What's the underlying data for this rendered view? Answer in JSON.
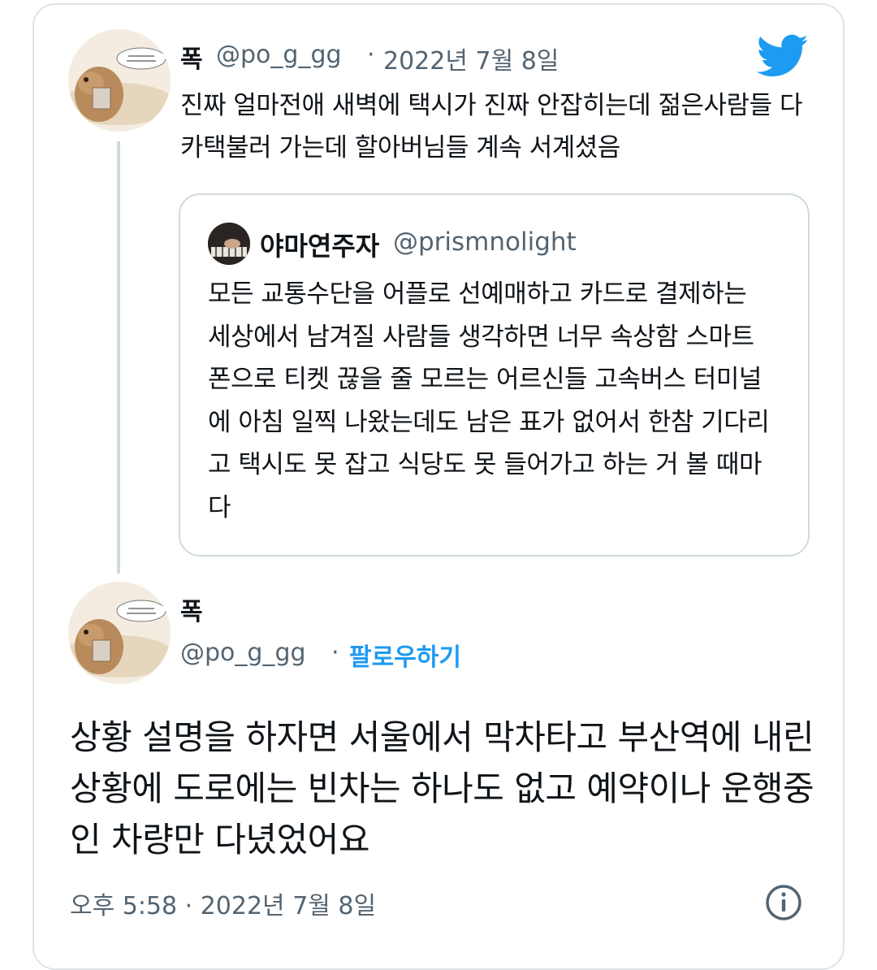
{
  "tweet": {
    "author_name": "폭",
    "author_handle": "@po_g_gg",
    "separator": "·",
    "date": "2022년 7월 8일",
    "text": "진짜 얼마전애 새벽에 택시가 진짜 안잡히는데 젊은사람들 다 카택불러 가는데 할아버님들 계속 서계셨음"
  },
  "quoted": {
    "author_name": "야마연주자",
    "author_handle": "@prismnolight",
    "text": "모든 교통수단을 어플로 선예매하고 카드로 결제하는 세상에서 남겨질 사람들 생각하면 너무 속상함 스마트폰으로 티켓 끊을 줄 모르는 어르신들 고속버스 터미널에 아침 일찍 나왔는데도 남은 표가 없어서 한참 기다리고 택시도 못 잡고 식당도 못 들어가고 하는 거 볼 때마다"
  },
  "reply": {
    "author_name": "폭",
    "author_handle": "@po_g_gg",
    "separator": "·",
    "follow_label": "팔로우하기",
    "text": "상황 설명을 하자면 서울에서 막차타고 부산역에 내린 상황에 도로에는 빈차는 하나도 없고 예약이나 운행중인 차량만 다녔었어요",
    "timestamp": "오후 5:58 · 2022년 7월 8일"
  },
  "icons": {
    "brand": "twitter-bird-icon",
    "info": "info-icon"
  },
  "colors": {
    "brand": "#1d9bf0",
    "text": "#0f1419",
    "muted": "#536471",
    "border": "#cfd9de"
  }
}
